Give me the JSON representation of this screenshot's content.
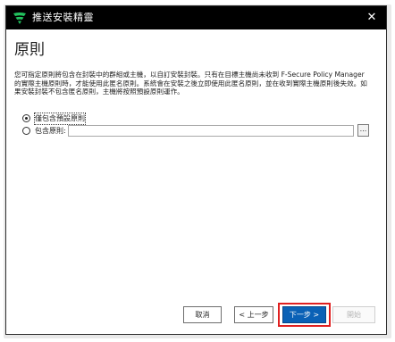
{
  "window": {
    "title": "推送安裝精靈",
    "close_glyph": "✕"
  },
  "page": {
    "heading": "原則",
    "description": "您可指定原則將包含在封裝中的群組或主機，以自訂安裝封裝。只有在目標主機尚未收到 F-Secure Policy Manager 的實際主機原則時，才能使用此匿名原則。系統會在安裝之後立即使用此匿名原則，並在收到實際主機原則後失效。如果安裝封裝不包含匿名原則，主機將按照預設原則運作。"
  },
  "options": {
    "default_policy": {
      "label": "僅包含預設原則",
      "selected": true
    },
    "include_policy": {
      "label": "包含原則:",
      "selected": false,
      "value": "",
      "browse_label": "..."
    }
  },
  "buttons": {
    "cancel": "取消",
    "back": "< 上一步",
    "next": "下一步 >",
    "start": "開始"
  },
  "colors": {
    "titlebar": "#000000",
    "primary_button": "#0a61b6",
    "highlight": "#e02020",
    "logo": "#22c35e"
  }
}
